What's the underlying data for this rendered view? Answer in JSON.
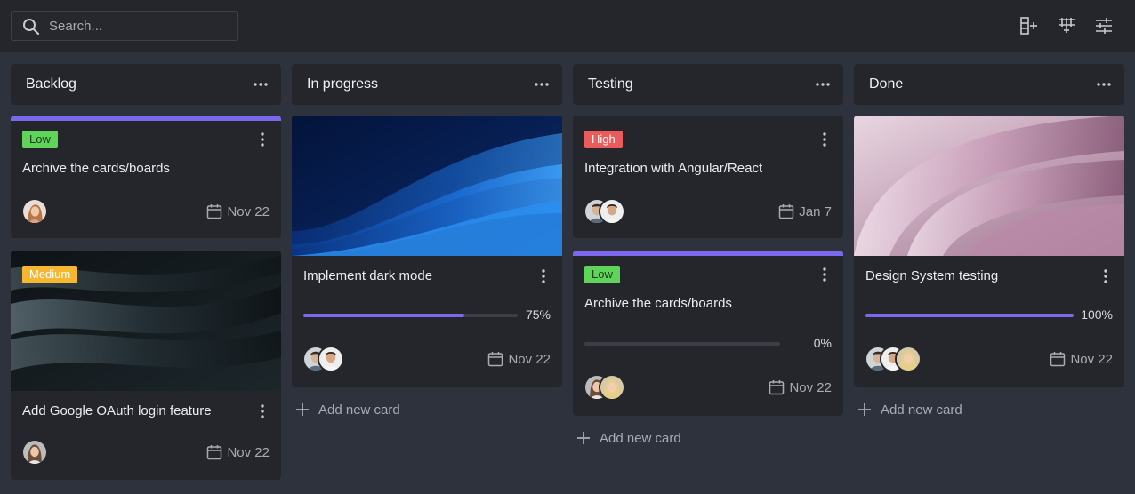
{
  "search": {
    "placeholder": "Search..."
  },
  "toolbar": {
    "add_column_icon": "column-add-icon",
    "grid_icon": "column-grid-icon",
    "settings_icon": "sliders-icon"
  },
  "colors": {
    "background": "#2e323d",
    "panel": "#24262b",
    "accent": "#7b68ee",
    "low": "#5fd35a",
    "high": "#ec5b5b",
    "medium": "#f5b731"
  },
  "columns": [
    {
      "title": "Backlog",
      "cards": [
        {
          "priority": "Low",
          "title": "Archive the cards/boards",
          "date": "Nov 22"
        },
        {
          "priority": "Medium",
          "title": "Add Google OAuth login feature",
          "date": "Nov 22"
        }
      ]
    },
    {
      "title": "In progress",
      "cards": [
        {
          "title": "Implement dark mode",
          "progress": "75%",
          "progress_value": 0.75,
          "date": "Nov 22"
        }
      ],
      "add_label": "Add new card"
    },
    {
      "title": "Testing",
      "cards": [
        {
          "priority": "High",
          "title": "Integration with Angular/React",
          "date": "Jan 7"
        },
        {
          "priority": "Low",
          "title": "Archive the cards/boards",
          "progress": "0%",
          "progress_value": 0,
          "date": "Nov 22"
        }
      ],
      "add_label": "Add new card"
    },
    {
      "title": "Done",
      "cards": [
        {
          "title": "Design System testing",
          "progress": "100%",
          "progress_value": 1,
          "date": "Nov 22"
        }
      ],
      "add_label": "Add new card"
    }
  ]
}
